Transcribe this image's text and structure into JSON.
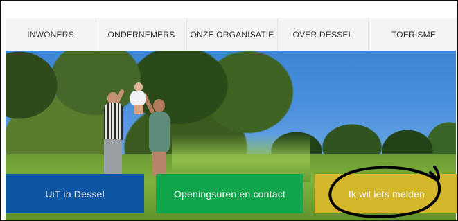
{
  "nav": {
    "items": [
      {
        "label": "INWONERS"
      },
      {
        "label": "ONDERNEMERS"
      },
      {
        "label": "ONZE ORGANISATIE"
      },
      {
        "label": "OVER DESSEL"
      },
      {
        "label": "TOERISME"
      }
    ]
  },
  "tiles": {
    "uit": {
      "label": "UiT in Dessel",
      "color": "#0c55a3"
    },
    "openingsuren": {
      "label": "Openingsuren en contact",
      "color": "#11a54c"
    },
    "melden": {
      "label": "Ik wil iets melden",
      "color": "#d4b62a"
    }
  },
  "hero": {
    "icon": "family-in-park-photo"
  },
  "annotation": {
    "icon": "hand-drawn-circle-icon",
    "color": "#000000"
  }
}
